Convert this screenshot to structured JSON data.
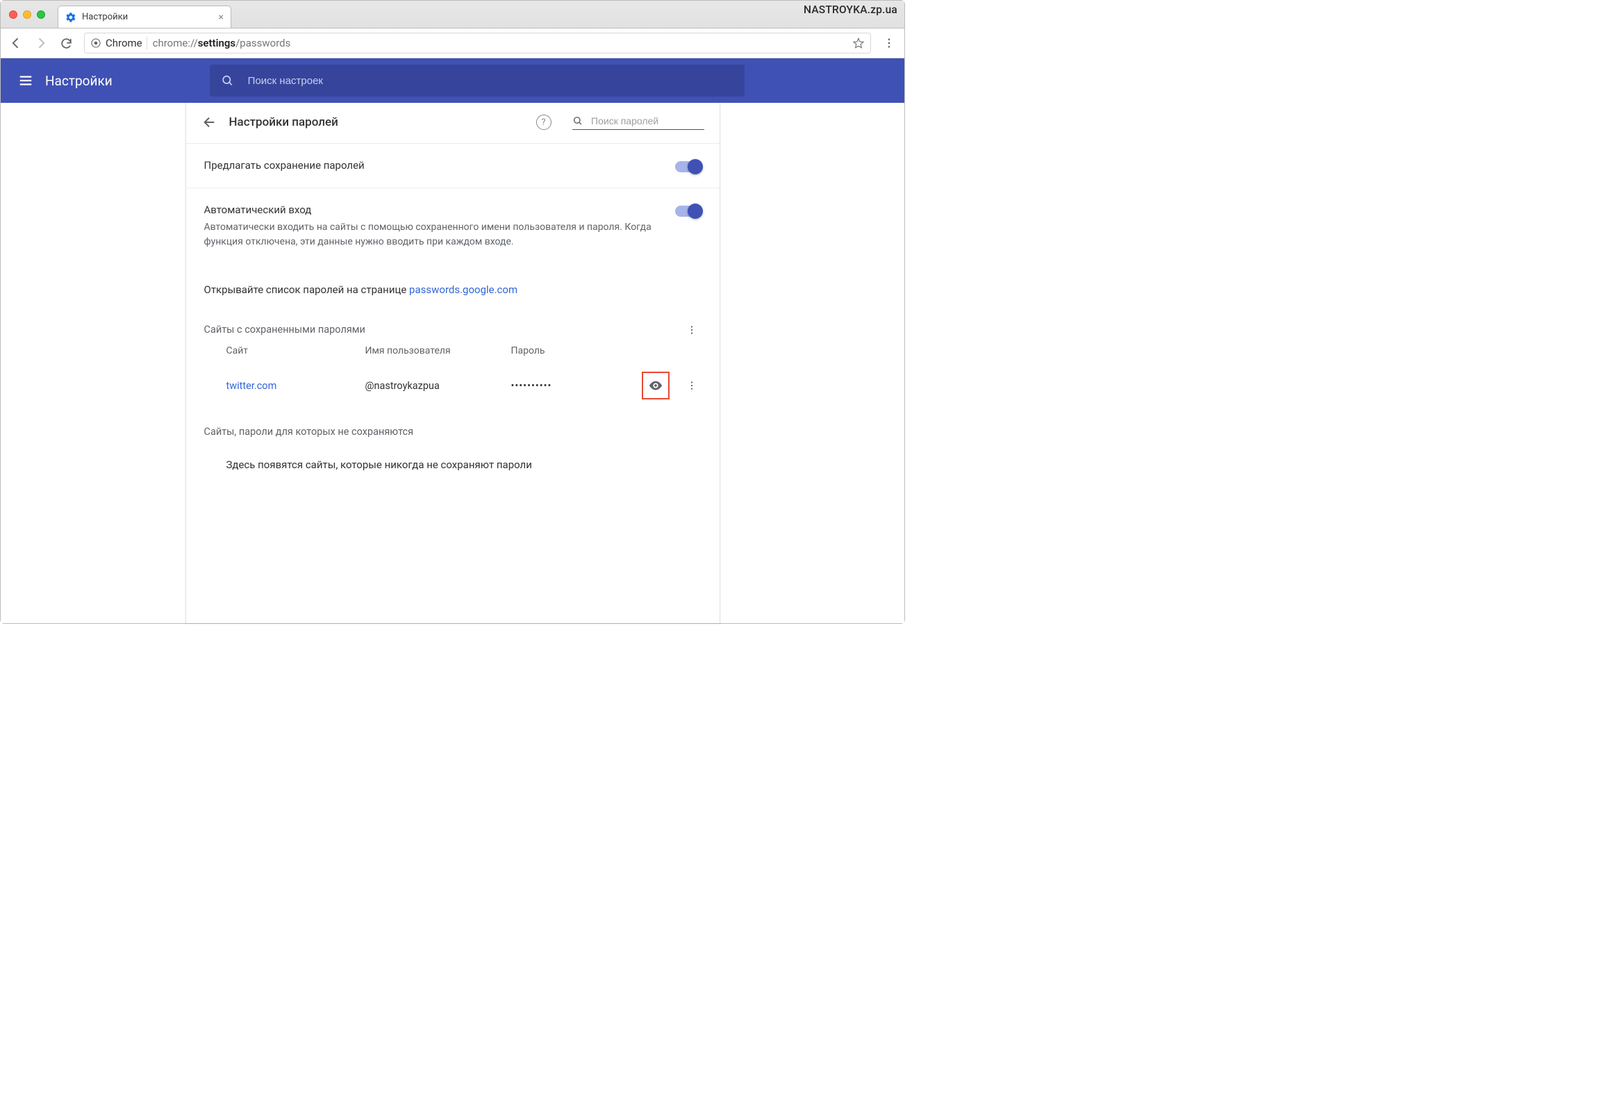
{
  "window": {
    "tab_title": "Настройки",
    "watermark": "NASTROYKA.zp.ua"
  },
  "toolbar": {
    "chrome_label": "Chrome",
    "url_prefix": "chrome://",
    "url_bold": "settings",
    "url_suffix": "/passwords"
  },
  "bluebar": {
    "app_name": "Настройки",
    "search_placeholder": "Поиск настроек"
  },
  "page": {
    "title": "Настройки паролей",
    "pwdsearch_placeholder": "Поиск паролей",
    "offer_save_label": "Предлагать сохранение паролей",
    "auto_signin_title": "Автоматический вход",
    "auto_signin_desc": "Автоматически входить на сайты с помощью сохраненного имени пользователя и пароля. Когда функция отключена, эти данные нужно вводить при каждом входе.",
    "passwords_hint_prefix": "Открывайте список паролей на странице ",
    "passwords_hint_link": "passwords.google.com",
    "saved_title": "Сайты с сохраненными паролями",
    "cols": {
      "site": "Сайт",
      "user": "Имя пользователя",
      "pass": "Пароль"
    },
    "rows": [
      {
        "site": "twitter.com",
        "user": "@nastroykazpua",
        "pass": "••••••••••"
      }
    ],
    "never_title": "Сайты, пароли для которых не сохраняются",
    "never_empty": "Здесь появятся сайты, которые никогда не сохраняют пароли"
  }
}
